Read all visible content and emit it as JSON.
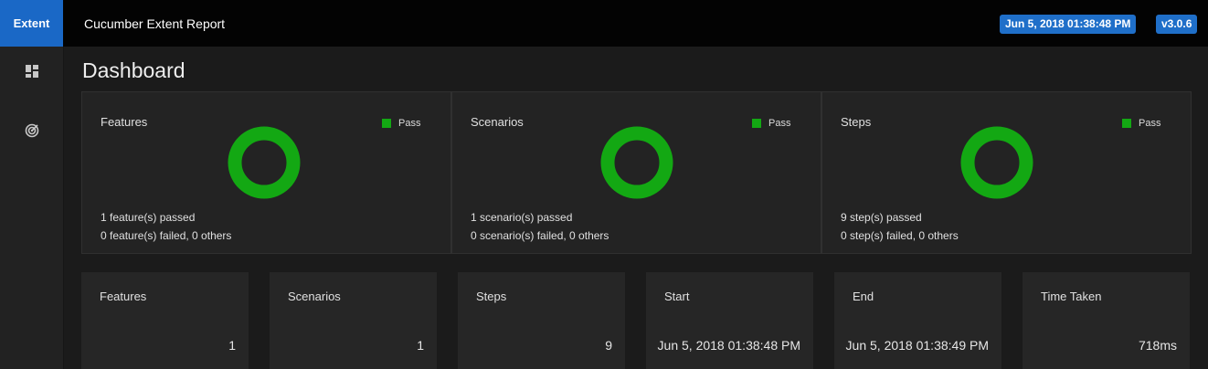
{
  "topbar": {
    "brand": "Extent",
    "report_name": "Cucumber Extent Report",
    "date": "Jun 5, 2018 01:38:48 PM",
    "version": "v3.0.6"
  },
  "sidebar": {
    "items": [
      {
        "icon": "dashboard-icon"
      },
      {
        "icon": "radar-icon"
      }
    ]
  },
  "page": {
    "title": "Dashboard"
  },
  "colors": {
    "pass": "#13a813",
    "accent": "#1a68c6"
  },
  "cards": [
    {
      "title": "Features",
      "legend": "Pass",
      "summary_pass": "1 feature(s) passed",
      "summary_other": "0 feature(s) failed, 0 others"
    },
    {
      "title": "Scenarios",
      "legend": "Pass",
      "summary_pass": "1 scenario(s) passed",
      "summary_other": "0 scenario(s) failed, 0 others"
    },
    {
      "title": "Steps",
      "legend": "Pass",
      "summary_pass": "9 step(s) passed",
      "summary_other": "0 step(s) failed, 0 others"
    }
  ],
  "stats": [
    {
      "label": "Features",
      "value": "1"
    },
    {
      "label": "Scenarios",
      "value": "1"
    },
    {
      "label": "Steps",
      "value": "9"
    },
    {
      "label": "Start",
      "value": "Jun 5, 2018 01:38:48 PM"
    },
    {
      "label": "End",
      "value": "Jun 5, 2018 01:38:49 PM"
    },
    {
      "label": "Time Taken",
      "value": "718ms"
    }
  ]
}
